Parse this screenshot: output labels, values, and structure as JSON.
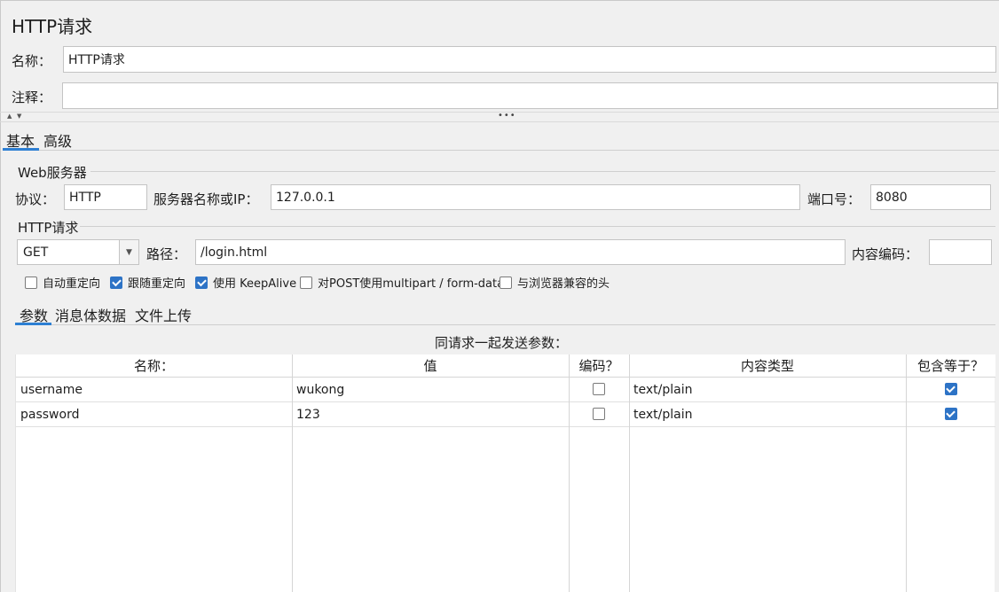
{
  "title": "HTTP请求",
  "name_label": "名称：",
  "name_value": "HTTP请求",
  "comment_label": "注释：",
  "comment_value": "",
  "tabs": [
    "基本",
    "高级"
  ],
  "web_server": {
    "group_title": "Web服务器",
    "protocol_label": "协议：",
    "protocol_value": "HTTP",
    "server_label": "服务器名称或IP：",
    "server_value": "127.0.0.1",
    "port_label": "端口号：",
    "port_value": "8080"
  },
  "http_request": {
    "group_title": "HTTP请求",
    "method": "GET",
    "path_label": "路径：",
    "path_value": "/login.html",
    "encoding_label": "内容编码：",
    "encoding_value": ""
  },
  "options": [
    {
      "label": "自动重定向",
      "checked": false
    },
    {
      "label": "跟随重定向",
      "checked": true
    },
    {
      "label": "使用 KeepAlive",
      "checked": true
    },
    {
      "label": "对POST使用multipart / form-data",
      "checked": false
    },
    {
      "label": "与浏览器兼容的头",
      "checked": false
    }
  ],
  "sub_tabs": [
    "参数",
    "消息体数据",
    "文件上传"
  ],
  "params_caption": "同请求一起发送参数：",
  "table": {
    "columns": [
      "名称：",
      "值",
      "编码？",
      "内容类型",
      "包含等于？"
    ],
    "rows": [
      {
        "name": "username",
        "value": "wukong",
        "encode": false,
        "content_type": "text/plain",
        "include_equals": true
      },
      {
        "name": "password",
        "value": "123",
        "encode": false,
        "content_type": "text/plain",
        "include_equals": true
      }
    ]
  }
}
